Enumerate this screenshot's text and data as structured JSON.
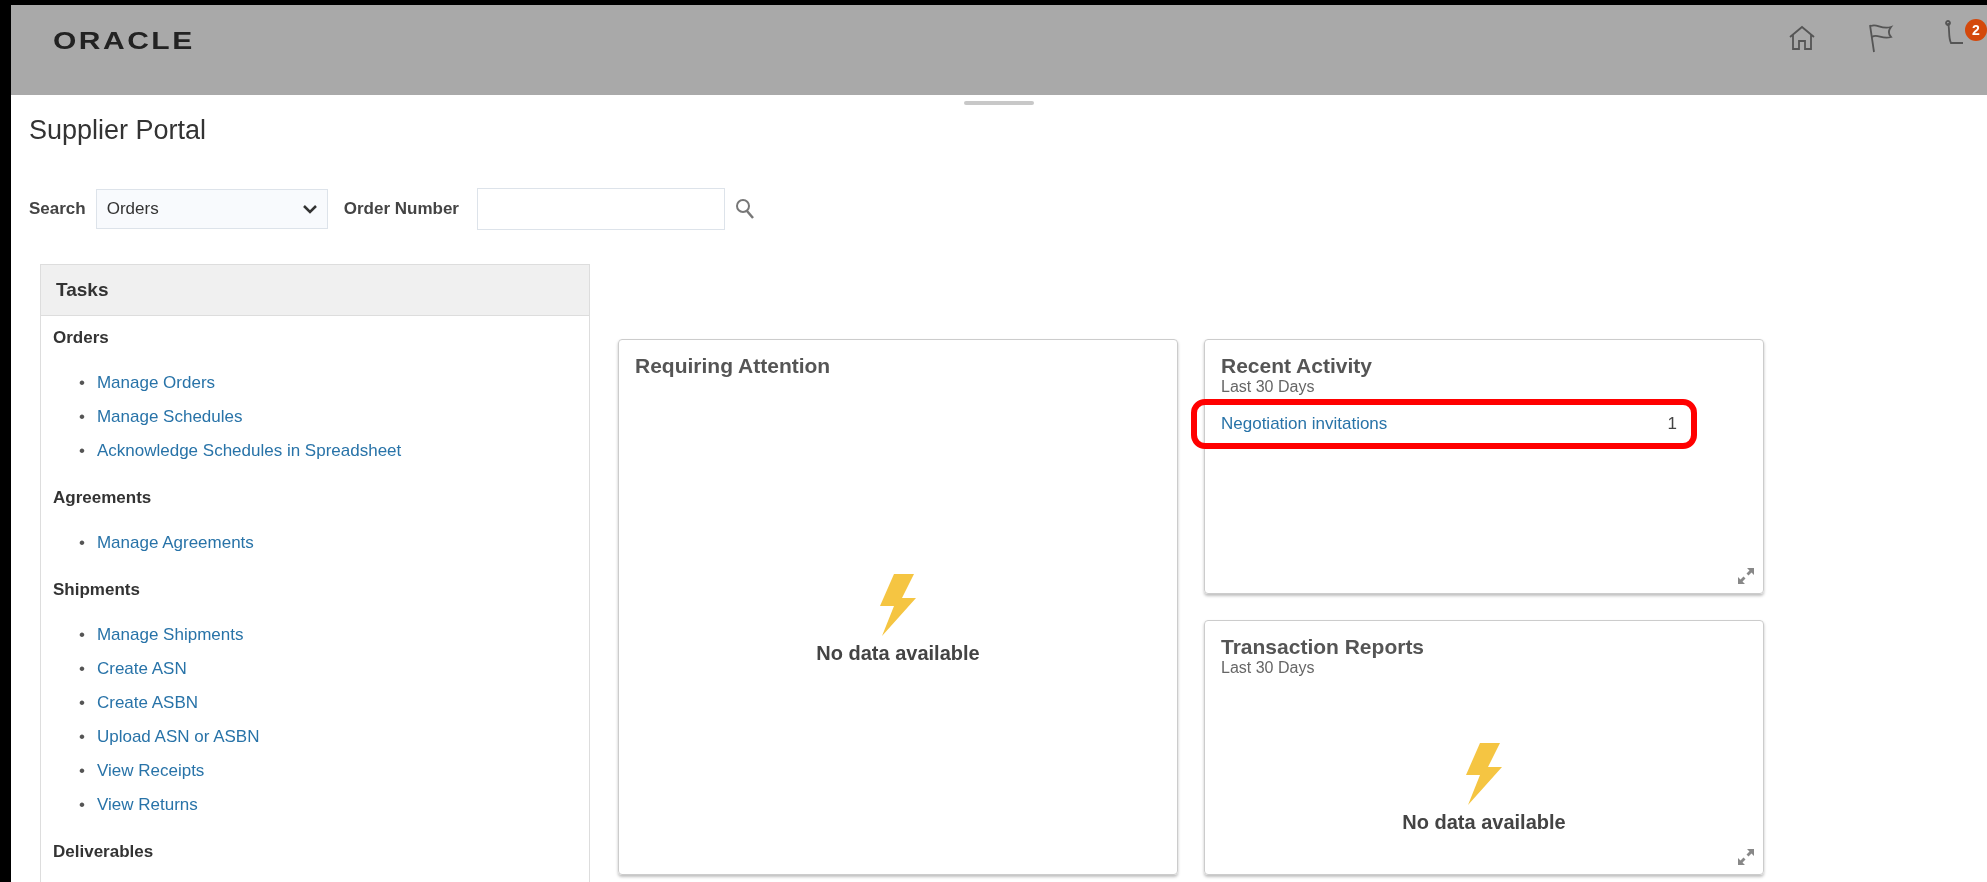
{
  "header": {
    "logo": "ORACLE",
    "notification_count": "2"
  },
  "page_title": "Supplier Portal",
  "search": {
    "label": "Search",
    "select_value": "Orders",
    "field_label": "Order Number"
  },
  "tasks": {
    "title": "Tasks",
    "bullet": "•",
    "sections": [
      {
        "title": "Orders",
        "items": [
          "Manage Orders",
          "Manage Schedules",
          "Acknowledge Schedules in Spreadsheet"
        ]
      },
      {
        "title": "Agreements",
        "items": [
          "Manage Agreements"
        ]
      },
      {
        "title": "Shipments",
        "items": [
          "Manage Shipments",
          "Create ASN",
          "Create ASBN",
          "Upload ASN or ASBN",
          "View Receipts",
          "View Returns"
        ]
      },
      {
        "title": "Deliverables"
      }
    ]
  },
  "cards": [
    {
      "kind": "empty",
      "title": "Requiring Attention",
      "message": "No data available"
    },
    {
      "kind": "list",
      "title": "Recent Activity",
      "subtitle": "Last 30 Days",
      "rows": [
        {
          "label": "Negotiation invitations",
          "count": "1",
          "highlighted": true
        }
      ]
    },
    {
      "kind": "empty",
      "title": "Transaction Reports",
      "subtitle": "Last 30 Days",
      "message": "No data available"
    }
  ]
}
